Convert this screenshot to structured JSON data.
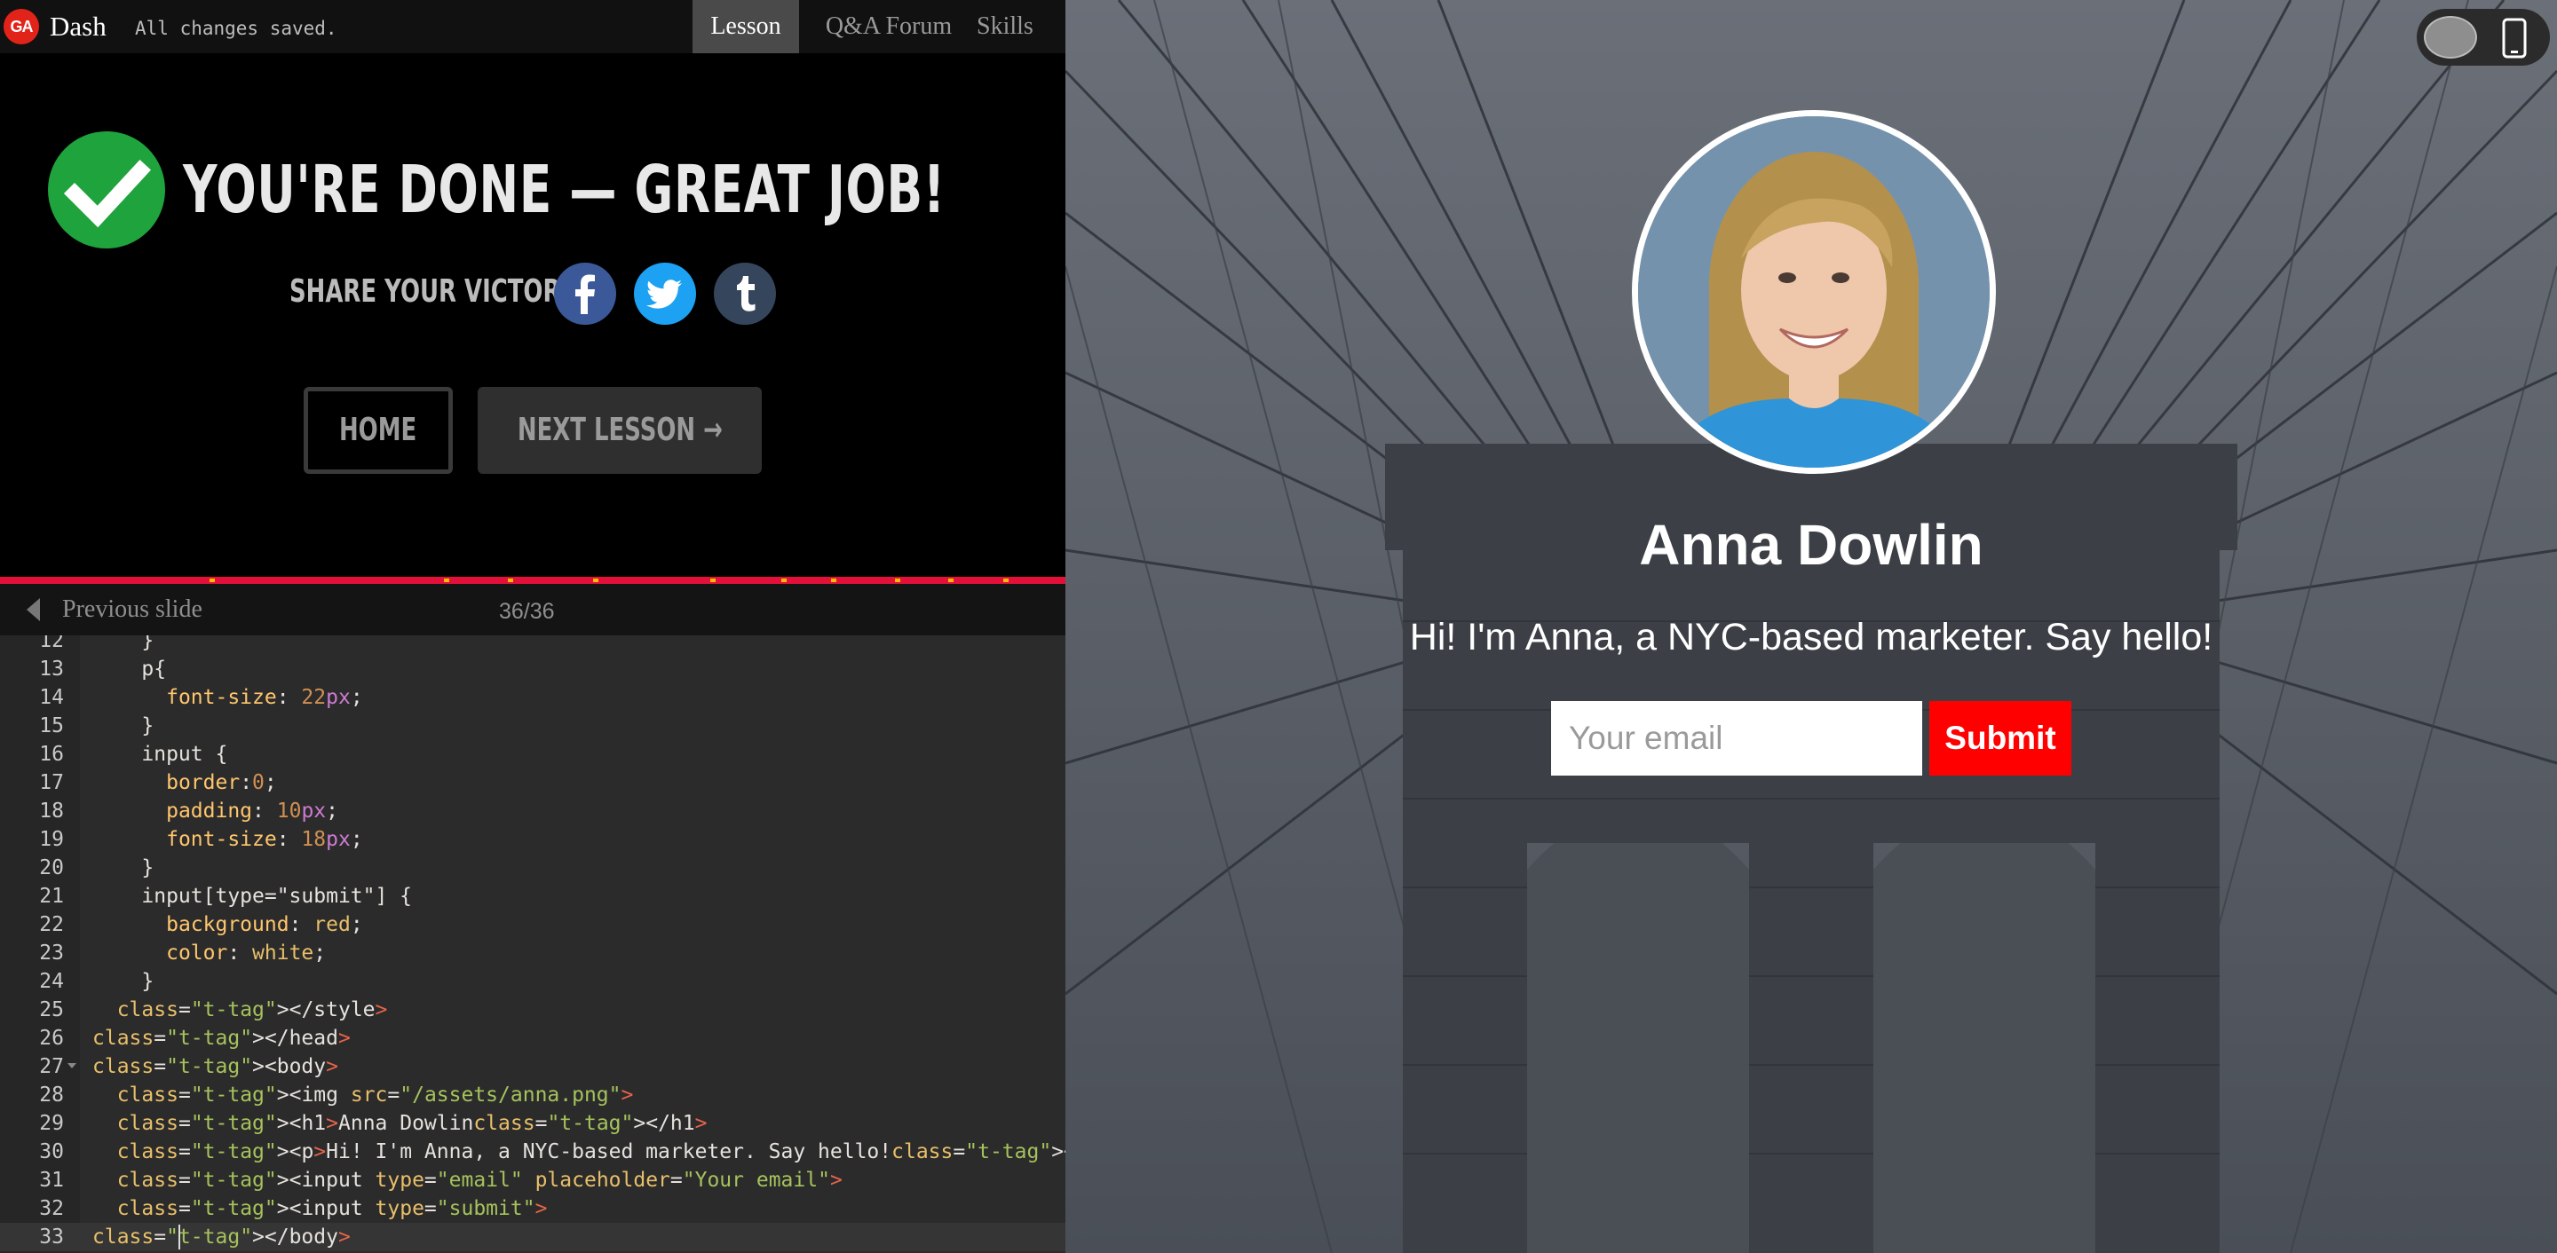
{
  "topbar": {
    "logo_text": "GA",
    "app_title": "Dash",
    "save_status": "All changes saved.",
    "tabs": [
      {
        "label": "Lesson",
        "active": true
      },
      {
        "label": "Q&A Forum",
        "active": false
      },
      {
        "label": "Skills",
        "active": false
      }
    ]
  },
  "completion": {
    "title": "YOU'RE DONE — GREAT JOB!",
    "share_label": "SHARE YOUR VICTORY:",
    "social_icons": [
      "facebook-icon",
      "twitter-icon",
      "tumblr-icon"
    ],
    "home_button": "HOME",
    "next_button": "NEXT LESSON →"
  },
  "slides": {
    "prev_label": "Previous slide",
    "counter": "36/36"
  },
  "editor": {
    "lines": [
      {
        "n": "12",
        "text": "    }"
      },
      {
        "n": "13",
        "text": "    p{"
      },
      {
        "n": "14",
        "text": "      font-size: 22px;"
      },
      {
        "n": "15",
        "text": "    }"
      },
      {
        "n": "16",
        "text": "    input {"
      },
      {
        "n": "17",
        "text": "      border:0;"
      },
      {
        "n": "18",
        "text": "      padding: 10px;"
      },
      {
        "n": "19",
        "text": "      font-size: 18px;"
      },
      {
        "n": "20",
        "text": "    }"
      },
      {
        "n": "21",
        "text": "    input[type=\"submit\"] {"
      },
      {
        "n": "22",
        "text": "      background: red;"
      },
      {
        "n": "23",
        "text": "      color: white;"
      },
      {
        "n": "24",
        "text": "    }"
      },
      {
        "n": "25",
        "text": "  </style>"
      },
      {
        "n": "26",
        "text": "</head>"
      },
      {
        "n": "27",
        "text": "<body>"
      },
      {
        "n": "28",
        "text": "  <img src=\"/assets/anna.png\">"
      },
      {
        "n": "29",
        "text": "  <h1>Anna Dowlin</h1>"
      },
      {
        "n": "30",
        "text": "  <p>Hi! I'm Anna, a NYC-based marketer. Say hello!</p>"
      },
      {
        "n": "31",
        "text": "  <input type=\"email\" placeholder=\"Your email\">"
      },
      {
        "n": "32",
        "text": "  <input type=\"submit\">"
      },
      {
        "n": "33",
        "text": "</body>"
      }
    ]
  },
  "preview": {
    "name": "Anna Dowlin",
    "bio": "Hi! I'm Anna, a NYC-based marketer. Say hello!",
    "email_placeholder": "Your email",
    "submit_label": "Submit"
  },
  "colors": {
    "progress": "#e3103a",
    "check": "#1fa33c",
    "submit": "#ff0000",
    "facebook": "#3b5998",
    "twitter": "#1da1f2",
    "tumblr": "#35465c"
  }
}
